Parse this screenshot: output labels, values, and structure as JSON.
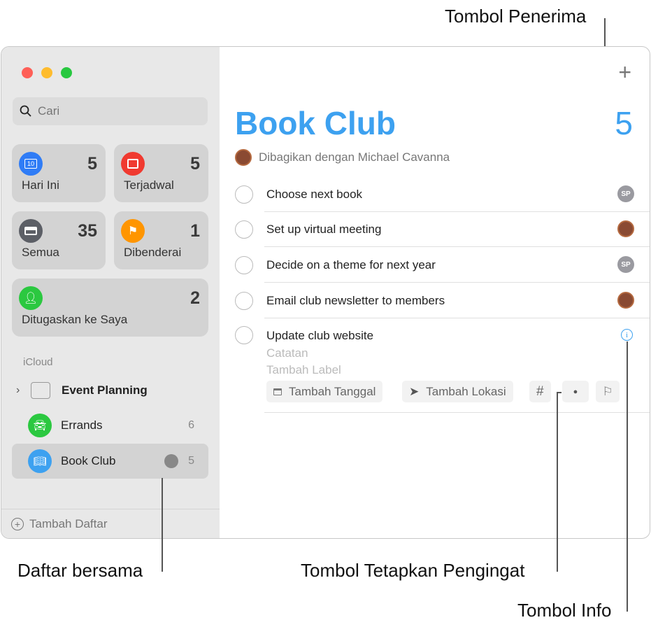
{
  "callouts": {
    "assignee": "Tombol Penerima",
    "shared_list": "Daftar bersama",
    "assign_reminder": "Tombol Tetapkan Pengingat",
    "info": "Tombol Info"
  },
  "window_controls": {
    "close_color": "#fe5f57",
    "minimize_color": "#febc2e",
    "zoom_color": "#28c840"
  },
  "sidebar": {
    "search_placeholder": "Cari",
    "smart_lists": [
      {
        "label": "Hari Ini",
        "count": "5",
        "icon": "calendar-today-icon",
        "color": "#2f7cf6",
        "glyph": "10"
      },
      {
        "label": "Terjadwal",
        "count": "5",
        "icon": "calendar-icon",
        "color": "#f03a30"
      },
      {
        "label": "Semua",
        "count": "35",
        "icon": "tray-icon",
        "color": "#5c5f66"
      },
      {
        "label": "Dibenderai",
        "count": "1",
        "icon": "flag-icon",
        "color": "#ff9500"
      },
      {
        "label": "Ditugaskan ke Saya",
        "count": "2",
        "icon": "person-icon",
        "color": "#2bc840"
      }
    ],
    "section": "iCloud",
    "lists": [
      {
        "label": "Event Planning",
        "icon": "folder-stack-icon"
      },
      {
        "label": "Errands",
        "count": "6",
        "icon": "car-icon",
        "color": "#2bc840"
      },
      {
        "label": "Book Club",
        "count": "5",
        "icon": "book-icon",
        "color": "#3da1f0",
        "shared": true
      }
    ],
    "add_list": "Tambah Daftar"
  },
  "main": {
    "title": "Book Club",
    "count": "5",
    "accent": "#3da1f0",
    "shared_with": "Dibagikan dengan Michael Cavanna",
    "reminders": [
      {
        "title": "Choose next book",
        "assignee": "SP"
      },
      {
        "title": "Set up virtual meeting",
        "assignee": "photo"
      },
      {
        "title": "Decide on a theme for next year",
        "assignee": "SP"
      },
      {
        "title": "Email club newsletter to members",
        "assignee": "photo"
      }
    ],
    "editing": {
      "title": "Update club website",
      "notes_placeholder": "Catatan",
      "tag_placeholder": "Tambah Label",
      "add_date": "Tambah Tanggal",
      "add_location": "Tambah Lokasi",
      "tag_symbol": "#"
    }
  }
}
